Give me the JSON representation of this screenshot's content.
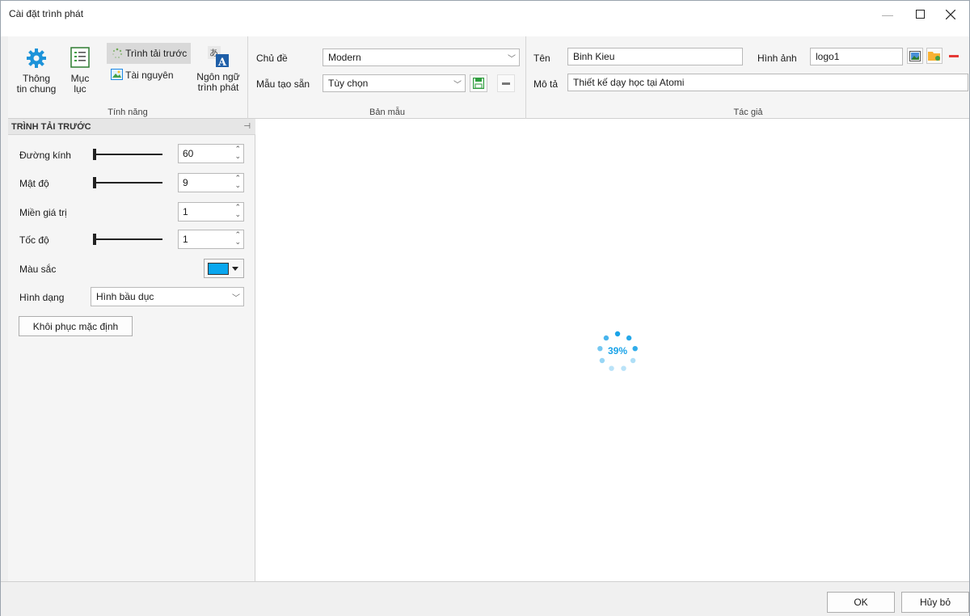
{
  "window": {
    "title": "Cài đặt trình phát"
  },
  "ribbon": {
    "features": {
      "general_label": "Thông tin chung",
      "toc_label": "Mục lục",
      "preloader_label": "Trình tải trước",
      "resources_label": "Tài nguyên",
      "language_label": "Ngôn ngữ trình phát",
      "caption": "Tính năng"
    },
    "template": {
      "theme_label": "Chủ đề",
      "theme_value": "Modern",
      "preset_label": "Mẫu tạo sẵn",
      "preset_value": "Tùy chọn",
      "caption": "Bản mẫu"
    },
    "author": {
      "name_label": "Tên",
      "name_value": "Binh Kieu",
      "image_label": "Hình ảnh",
      "image_value": "logo1",
      "desc_label": "Mô tả",
      "desc_value": "Thiết kế dạy học tại Atomi",
      "caption": "Tác giả"
    }
  },
  "preloader_panel": {
    "title": "TRÌNH TẢI TRƯỚC",
    "diameter_label": "Đường kính",
    "diameter_value": "60",
    "density_label": "Mật độ",
    "density_value": "9",
    "range_label": "Miền giá trị",
    "range_value": "1",
    "speed_label": "Tốc độ",
    "speed_value": "1",
    "color_label": "Màu sắc",
    "color_value": "#0aa7ef",
    "shape_label": "Hình dạng",
    "shape_value": "Hình bầu dục",
    "reset_label": "Khôi phục mặc định"
  },
  "preview": {
    "percent_text": "39%",
    "accent": "#1aa3e8"
  },
  "footer": {
    "ok_label": "OK",
    "cancel_label": "Hủy bỏ"
  }
}
